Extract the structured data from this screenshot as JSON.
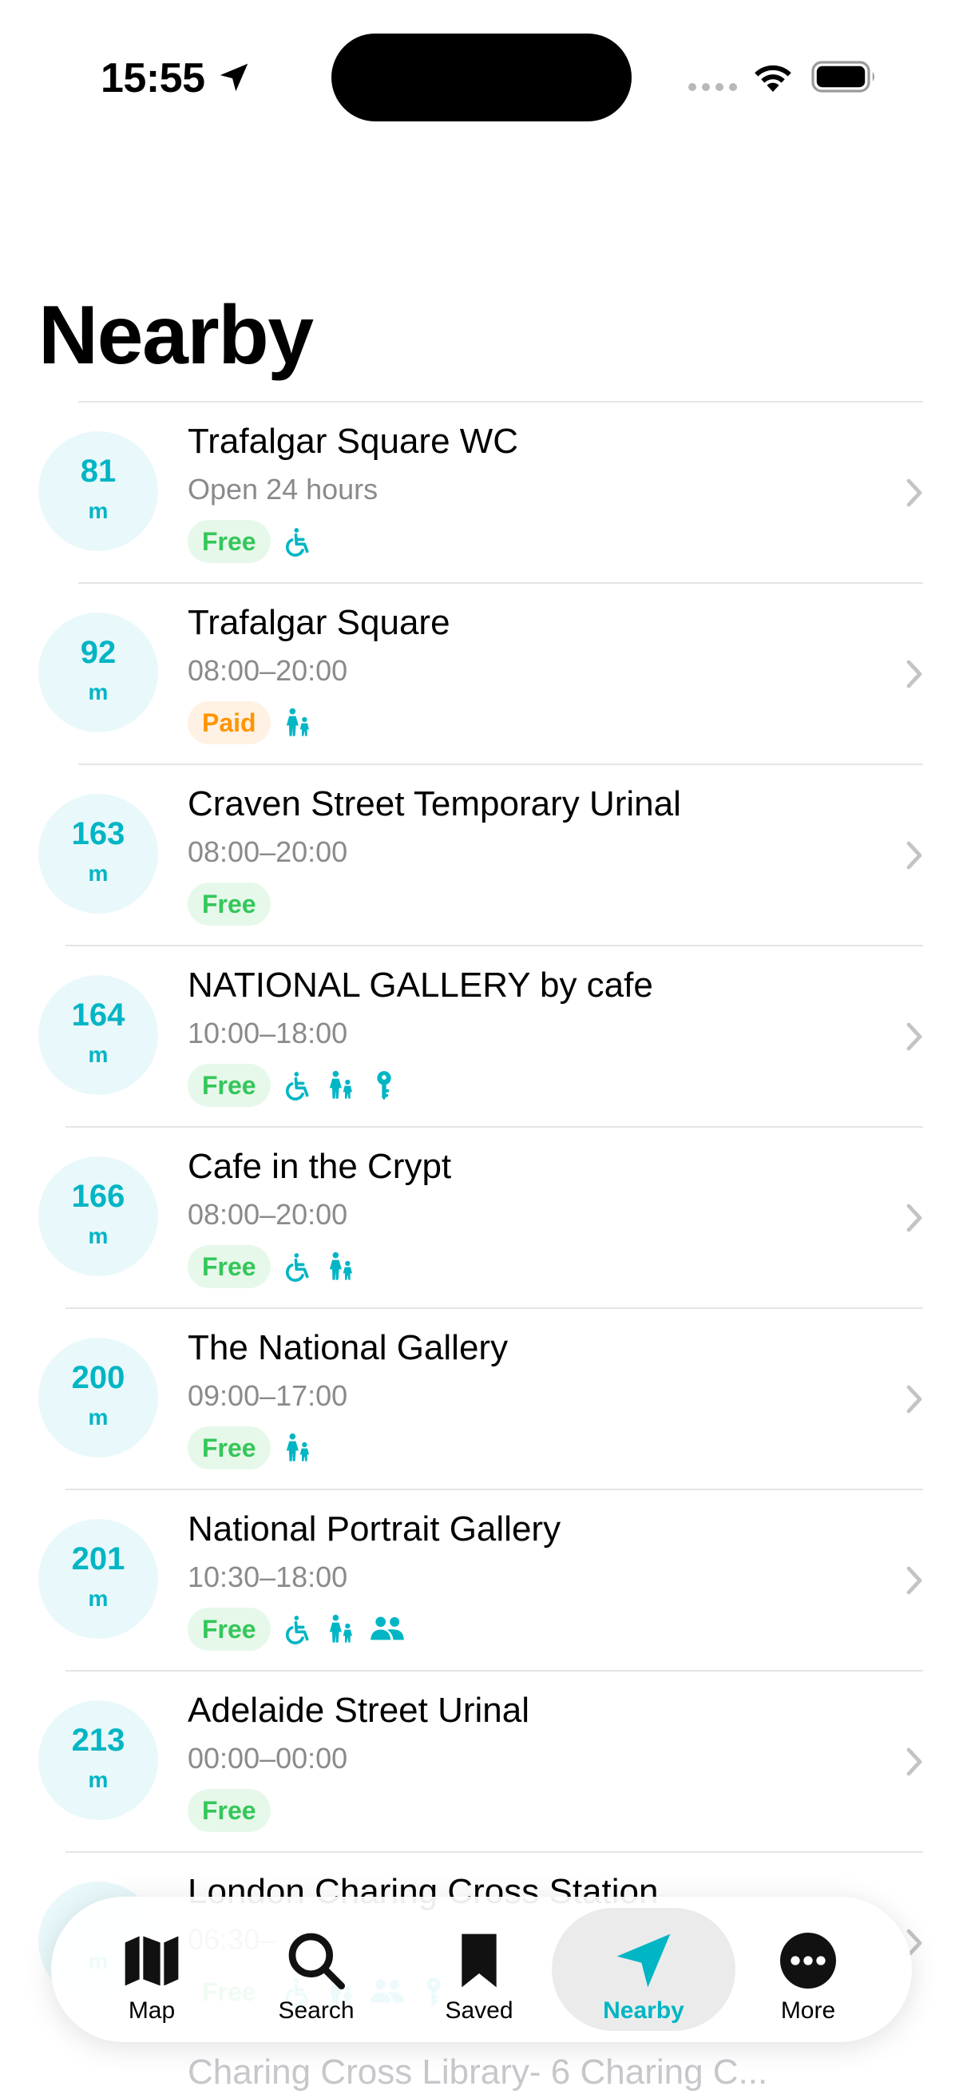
{
  "status_bar": {
    "time": "15:55"
  },
  "page": {
    "title": "Nearby"
  },
  "places": [
    {
      "distance": "81",
      "unit": "m",
      "name": "Trafalgar Square WC",
      "hours": "Open 24 hours",
      "price": "Free",
      "features": [
        "wheelchair-icon"
      ]
    },
    {
      "distance": "92",
      "unit": "m",
      "name": "Trafalgar Square",
      "hours": "08:00–20:00",
      "price": "Paid",
      "features": [
        "baby-change-icon"
      ]
    },
    {
      "distance": "163",
      "unit": "m",
      "name": "Craven Street Temporary Urinal",
      "hours": "08:00–20:00",
      "price": "Free",
      "features": []
    },
    {
      "distance": "164",
      "unit": "m",
      "name": "NATIONAL GALLERY by cafe",
      "hours": "10:00–18:00",
      "price": "Free",
      "features": [
        "wheelchair-icon",
        "baby-change-icon",
        "radar-key-icon"
      ]
    },
    {
      "distance": "166",
      "unit": "m",
      "name": "Cafe in the Crypt",
      "hours": "08:00–20:00",
      "price": "Free",
      "features": [
        "wheelchair-icon",
        "baby-change-icon"
      ]
    },
    {
      "distance": "200",
      "unit": "m",
      "name": "The National Gallery",
      "hours": "09:00–17:00",
      "price": "Free",
      "features": [
        "baby-change-icon"
      ]
    },
    {
      "distance": "201",
      "unit": "m",
      "name": "National Portrait Gallery",
      "hours": "10:30–18:00",
      "price": "Free",
      "features": [
        "wheelchair-icon",
        "baby-change-icon",
        "gender-neutral-icon"
      ]
    },
    {
      "distance": "213",
      "unit": "m",
      "name": "Adelaide Street Urinal",
      "hours": "00:00–00:00",
      "price": "Free",
      "features": []
    },
    {
      "distance": "",
      "unit": "m",
      "name": "London Charing Cross Station",
      "hours": "06:30–",
      "price": "Free",
      "features": [
        "wheelchair-icon",
        "baby-change-icon",
        "gender-neutral-icon",
        "radar-key-icon"
      ]
    }
  ],
  "partial_row": {
    "name": "Charing Cross Library- 6 Charing C..."
  },
  "tabs": [
    {
      "label": "Map",
      "icon": "map-icon"
    },
    {
      "label": "Search",
      "icon": "magnifier-icon"
    },
    {
      "label": "Saved",
      "icon": "bookmark-icon"
    },
    {
      "label": "Nearby",
      "icon": "location-arrow-icon",
      "active": true
    },
    {
      "label": "More",
      "icon": "ellipsis-icon"
    }
  ],
  "colors": {
    "accent": "#00b5c4",
    "free": "#34c759",
    "paid": "#ff9500"
  }
}
